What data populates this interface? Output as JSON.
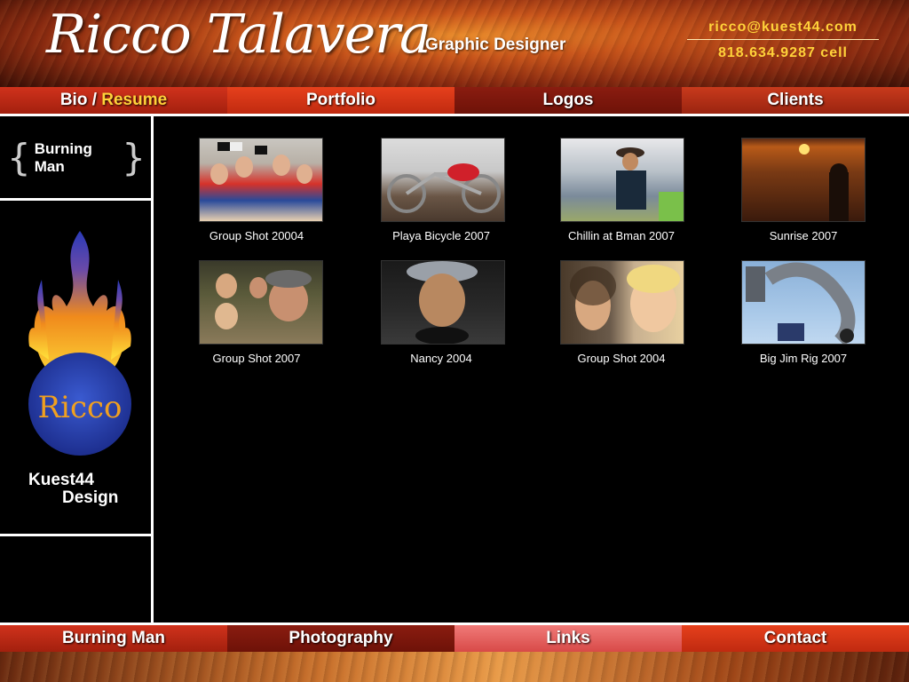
{
  "header": {
    "name": "Ricco Talavera",
    "tagline": "Graphic Designer",
    "email": "ricco@kuest44.com",
    "phone": "818.634.9287 cell"
  },
  "top_nav": {
    "bio": "Bio",
    "slash": " / ",
    "resume": "Resume",
    "portfolio": "Portfolio",
    "logos": "Logos",
    "clients": "Clients"
  },
  "sidebar": {
    "section": "Burning Man",
    "brand_line1": "Kuest44",
    "brand_line2": "Design",
    "logo_text": "Ricco"
  },
  "gallery": [
    {
      "caption": "Group Shot 20004"
    },
    {
      "caption": "Playa Bicycle 2007"
    },
    {
      "caption": "Chillin at Bman 2007"
    },
    {
      "caption": "Sunrise 2007"
    },
    {
      "caption": "Group Shot 2007"
    },
    {
      "caption": "Nancy 2004"
    },
    {
      "caption": "Group Shot 2004"
    },
    {
      "caption": "Big Jim Rig 2007"
    }
  ],
  "bottom_nav": {
    "burning_man": "Burning Man",
    "photography": "Photography",
    "links": "Links",
    "contact": "Contact"
  },
  "colors": {
    "accent_yellow": "#ffd23a",
    "nav_red": "#c02a10",
    "links_pink": "#f07a78",
    "background": "#000000"
  }
}
